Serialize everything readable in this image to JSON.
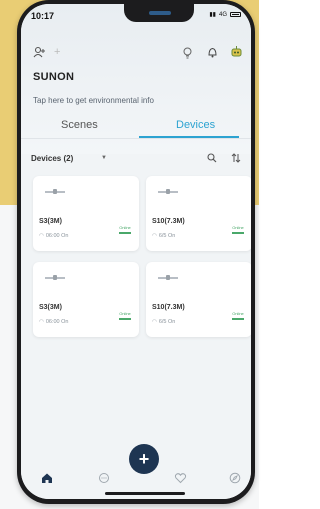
{
  "status_bar": {
    "time": "10:17",
    "network": "4G"
  },
  "header": {
    "brand": "SUNON",
    "env_prompt": "Tap here to get environmental info",
    "icons": [
      "user-add-icon",
      "plus-icon",
      "lightbulb-icon",
      "bell-icon",
      "robot-icon"
    ]
  },
  "tabs": [
    {
      "label": "Scenes",
      "active": false
    },
    {
      "label": "Devices",
      "active": true
    }
  ],
  "devices_section": {
    "title": "Devices (2)",
    "icons": [
      "filter-caret-icon",
      "search-icon",
      "sort-icon"
    ]
  },
  "devices": [
    {
      "name": "S3(3M)",
      "status": "06:00 On",
      "badge": "Online"
    },
    {
      "name": "S10(7.3M)",
      "status": "6/5 On",
      "badge": "Online"
    },
    {
      "name": "S3(3M)",
      "status": "06:00 On",
      "badge": "Online"
    },
    {
      "name": "S10(7.3M)",
      "status": "6/5 On",
      "badge": "Online"
    }
  ],
  "bottom_nav": {
    "items": [
      "home-icon",
      "chat-icon",
      "heart-scan-icon",
      "compass-icon"
    ],
    "fab": "+"
  },
  "colors": {
    "accent": "#2da3d1",
    "nav_dark": "#1e3552",
    "background_left": "#e9cd74"
  }
}
